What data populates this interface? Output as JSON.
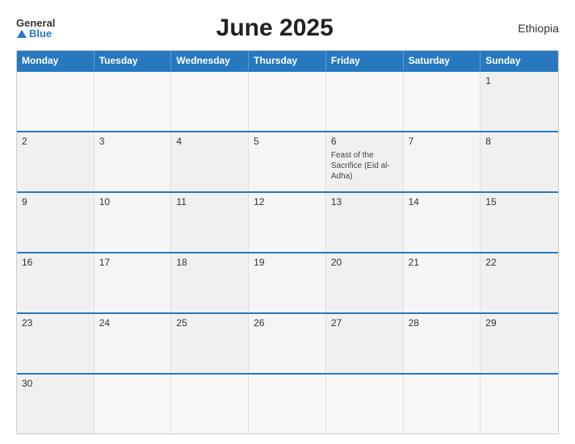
{
  "header": {
    "logo_general": "General",
    "logo_blue": "Blue",
    "title": "June 2025",
    "country": "Ethiopia"
  },
  "calendar": {
    "weekdays": [
      "Monday",
      "Tuesday",
      "Wednesday",
      "Thursday",
      "Friday",
      "Saturday",
      "Sunday"
    ],
    "rows": [
      [
        {
          "day": "",
          "empty": true
        },
        {
          "day": "",
          "empty": true
        },
        {
          "day": "",
          "empty": true
        },
        {
          "day": "",
          "empty": true
        },
        {
          "day": "",
          "empty": true
        },
        {
          "day": "",
          "empty": true
        },
        {
          "day": "1",
          "event": ""
        }
      ],
      [
        {
          "day": "2",
          "event": ""
        },
        {
          "day": "3",
          "event": ""
        },
        {
          "day": "4",
          "event": ""
        },
        {
          "day": "5",
          "event": ""
        },
        {
          "day": "6",
          "event": "Feast of the Sacrifice (Eid al-Adha)"
        },
        {
          "day": "7",
          "event": ""
        },
        {
          "day": "8",
          "event": ""
        }
      ],
      [
        {
          "day": "9",
          "event": ""
        },
        {
          "day": "10",
          "event": ""
        },
        {
          "day": "11",
          "event": ""
        },
        {
          "day": "12",
          "event": ""
        },
        {
          "day": "13",
          "event": ""
        },
        {
          "day": "14",
          "event": ""
        },
        {
          "day": "15",
          "event": ""
        }
      ],
      [
        {
          "day": "16",
          "event": ""
        },
        {
          "day": "17",
          "event": ""
        },
        {
          "day": "18",
          "event": ""
        },
        {
          "day": "19",
          "event": ""
        },
        {
          "day": "20",
          "event": ""
        },
        {
          "day": "21",
          "event": ""
        },
        {
          "day": "22",
          "event": ""
        }
      ],
      [
        {
          "day": "23",
          "event": ""
        },
        {
          "day": "24",
          "event": ""
        },
        {
          "day": "25",
          "event": ""
        },
        {
          "day": "26",
          "event": ""
        },
        {
          "day": "27",
          "event": ""
        },
        {
          "day": "28",
          "event": ""
        },
        {
          "day": "29",
          "event": ""
        }
      ],
      [
        {
          "day": "30",
          "event": ""
        },
        {
          "day": "",
          "empty": true
        },
        {
          "day": "",
          "empty": true
        },
        {
          "day": "",
          "empty": true
        },
        {
          "day": "",
          "empty": true
        },
        {
          "day": "",
          "empty": true
        },
        {
          "day": "",
          "empty": true
        }
      ]
    ]
  }
}
